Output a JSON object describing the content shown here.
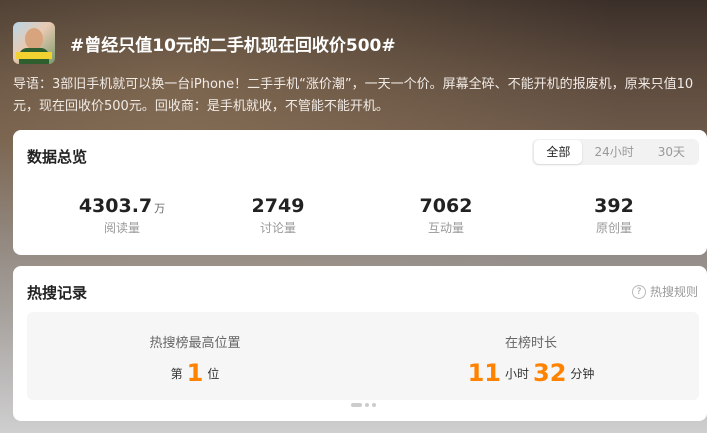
{
  "header": {
    "title": "#曾经只值10元的二手机现在回收价500#"
  },
  "intro": "导语：3部旧手机就可以换一台iPhone！二手手机“涨价潮”，一天一个价。屏幕全碎、不能开机的报废机，原来只值10元，现在回收价500元。回收商：是手机就收，不管能不能开机。",
  "overview": {
    "title": "数据总览",
    "tabs": [
      "全部",
      "24小时",
      "30天"
    ],
    "stats": [
      {
        "value": "4303.7",
        "unit": "万",
        "label": "阅读量"
      },
      {
        "value": "2749",
        "unit": "",
        "label": "讨论量"
      },
      {
        "value": "7062",
        "unit": "",
        "label": "互动量"
      },
      {
        "value": "392",
        "unit": "",
        "label": "原创量"
      }
    ]
  },
  "hot": {
    "title": "热搜记录",
    "rules_label": "热搜规则",
    "rules_icon_glyph": "?",
    "highest": {
      "label": "热搜榜最高位置",
      "prefix": "第",
      "value": "1",
      "suffix": "位"
    },
    "duration": {
      "label": "在榜时长",
      "hours": "11",
      "hours_unit": "小时",
      "minutes": "32",
      "minutes_unit": "分钟"
    }
  },
  "colors": {
    "accent": "#ff8200"
  }
}
